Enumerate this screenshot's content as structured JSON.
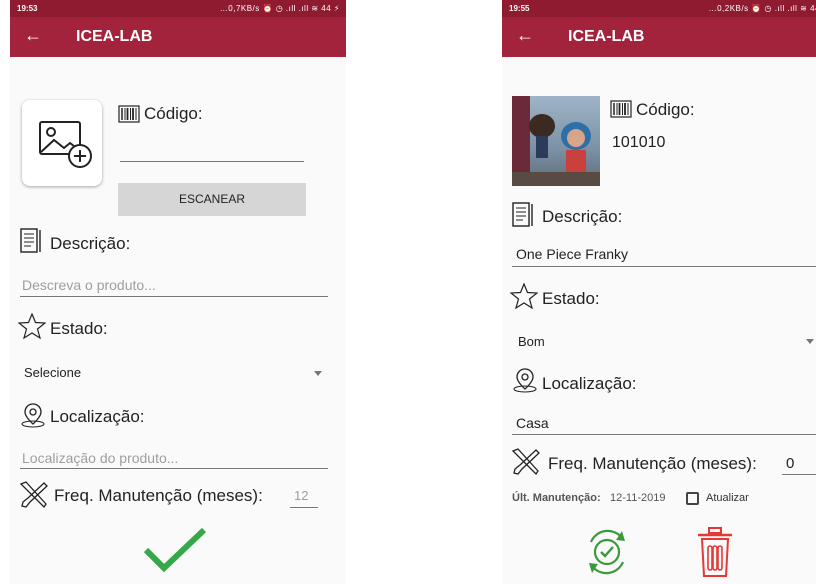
{
  "left": {
    "status": {
      "time": "19:53",
      "icons": "…0,7KB/s ⏰ ◷ .ıll .ıll ≋ 44 ⚡"
    },
    "appbar": {
      "back": "←",
      "title": "ICEA-LAB"
    },
    "codigo": {
      "label": "Código:",
      "value": ""
    },
    "scan_button": "ESCANEAR",
    "descricao": {
      "label": "Descrição:",
      "placeholder": "Descreva o produto..."
    },
    "estado": {
      "label": "Estado:",
      "selected": "Selecione"
    },
    "localizacao": {
      "label": "Localização:",
      "placeholder": "Localização do produto..."
    },
    "freq": {
      "label": "Freq. Manutenção (meses):",
      "value": "12"
    },
    "confirm_icon": "check-icon"
  },
  "right": {
    "status": {
      "time": "19:55",
      "icons": "…0,2KB/s ⏰ ◷ .ıll .ıll ≋ 44"
    },
    "appbar": {
      "back": "←",
      "title": "ICEA-LAB"
    },
    "codigo": {
      "label": "Código:",
      "value": "101010"
    },
    "descricao": {
      "label": "Descrição:",
      "value": "One Piece Franky"
    },
    "estado": {
      "label": "Estado:",
      "selected": "Bom"
    },
    "localizacao": {
      "label": "Localização:",
      "value": "Casa"
    },
    "freq": {
      "label": "Freq. Manutenção (meses):",
      "value": "0"
    },
    "ult_manut": {
      "label": "Últ. Manutenção:",
      "date": "12-11-2019",
      "atualizar": "Atualizar",
      "checked": false
    },
    "colors": {
      "accent": "#a3223c",
      "save_green": "#3a9a3a",
      "delete_red": "#e53935"
    }
  }
}
